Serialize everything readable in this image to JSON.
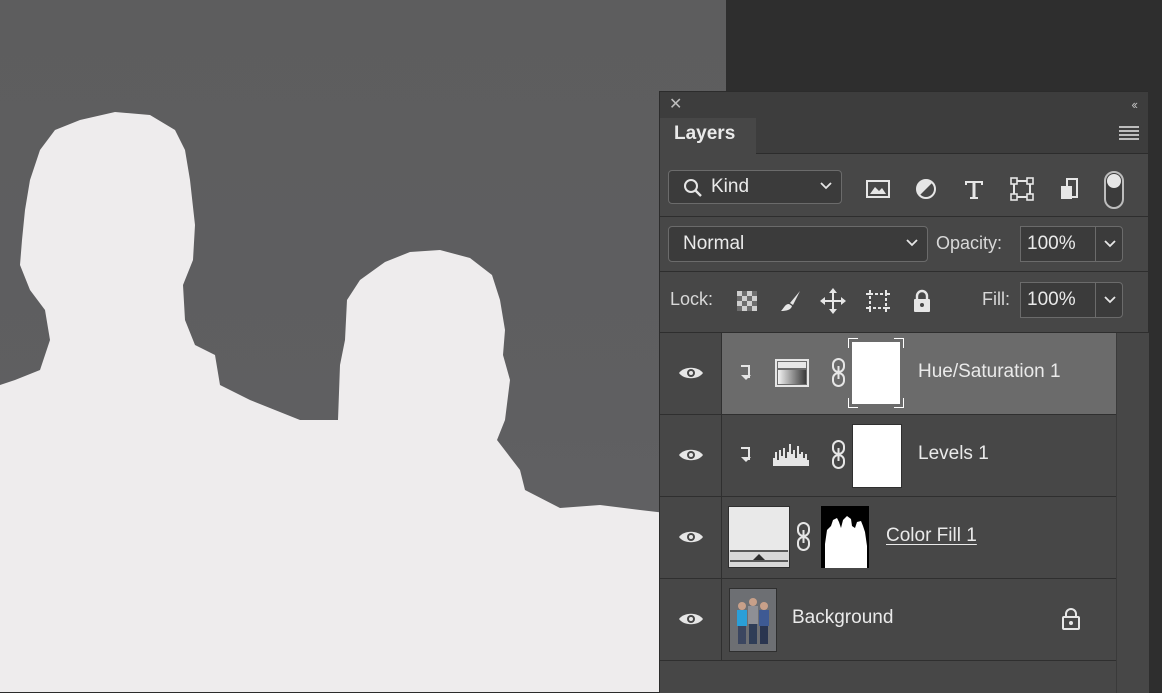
{
  "panel": {
    "tab_label": "Layers",
    "filter": {
      "kind_label": "Kind",
      "icons": [
        "image-filter-icon",
        "adjustment-filter-icon",
        "type-filter-icon",
        "shape-filter-icon",
        "smart-object-filter-icon"
      ]
    },
    "blend_mode": "Normal",
    "opacity_label": "Opacity:",
    "opacity_value": "100%",
    "lock_label": "Lock:",
    "fill_label": "Fill:",
    "fill_value": "100%"
  },
  "layers": [
    {
      "name": "Hue/Saturation 1",
      "type": "adjustment",
      "selected": true
    },
    {
      "name": "Levels 1",
      "type": "adjustment",
      "selected": false
    },
    {
      "name": "Color Fill 1",
      "type": "fill",
      "selected": false
    },
    {
      "name": "Background",
      "type": "image",
      "locked": true,
      "selected": false
    }
  ],
  "colors": {
    "panel_bg": "#474747",
    "selected_row": "#6b6b6b",
    "canvas_gray": "#5f5f61",
    "silhouette": "#eeeced"
  }
}
